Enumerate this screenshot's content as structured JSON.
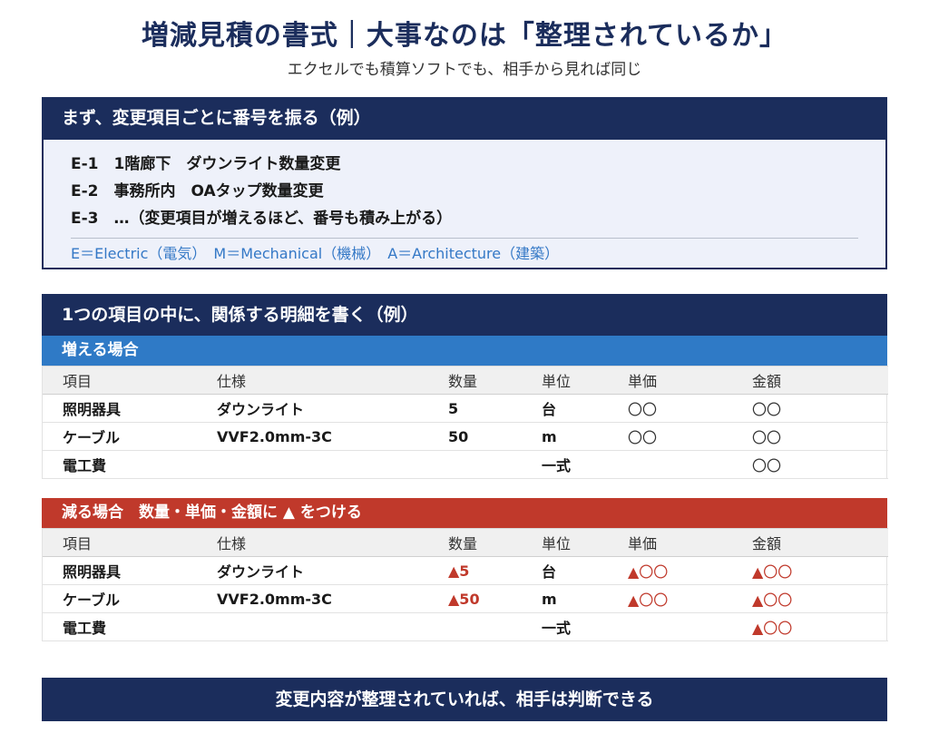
{
  "header": {
    "title": "増減見積の書式｜大事なのは「整理されているか」",
    "subtitle": "エクセルでも積算ソフトでも、相手から見れば同じ"
  },
  "numbering": {
    "heading": "まず、変更項目ごとに番号を振る（例）",
    "items": [
      "E-1　1階廊下　ダウンライト数量変更",
      "E-2　事務所内　OAタップ数量変更",
      "E-3　…（変更項目が増えるほど、番号も積み上がる）"
    ],
    "legend": "E＝Electric（電気）　M＝Mechanical（機械）　A＝Architecture（建築）"
  },
  "details": {
    "heading": "1つの項目の中に、関係する明細を書く（例）",
    "columns": [
      "項目",
      "仕様",
      "数量",
      "単位",
      "単価",
      "金額"
    ],
    "increase": {
      "label": "増える場合",
      "rows": [
        [
          "照明器具",
          "ダウンライト",
          "5",
          "台",
          "〇〇",
          "〇〇"
        ],
        [
          "ケーブル",
          "VVF2.0mm-3C",
          "50",
          "m",
          "〇〇",
          "〇〇"
        ],
        [
          "電工費",
          "",
          "",
          "一式",
          "",
          "〇〇"
        ]
      ]
    },
    "decrease": {
      "label": "減る場合　数量・単価・金額に ▲ をつける",
      "rows": [
        [
          "照明器具",
          "ダウンライト",
          "▲5",
          "台",
          "▲〇〇",
          "▲〇〇"
        ],
        [
          "ケーブル",
          "VVF2.0mm-3C",
          "▲50",
          "m",
          "▲〇〇",
          "▲〇〇"
        ],
        [
          "電工費",
          "",
          "",
          "一式",
          "",
          "▲〇〇"
        ]
      ]
    }
  },
  "footer": {
    "text": "変更内容が整理されていれば、相手は判断できる"
  },
  "colors": {
    "navy": "#1b2d5c",
    "blue": "#2f7ac6",
    "red": "#c0392b",
    "legend_text": "#3478c6"
  }
}
